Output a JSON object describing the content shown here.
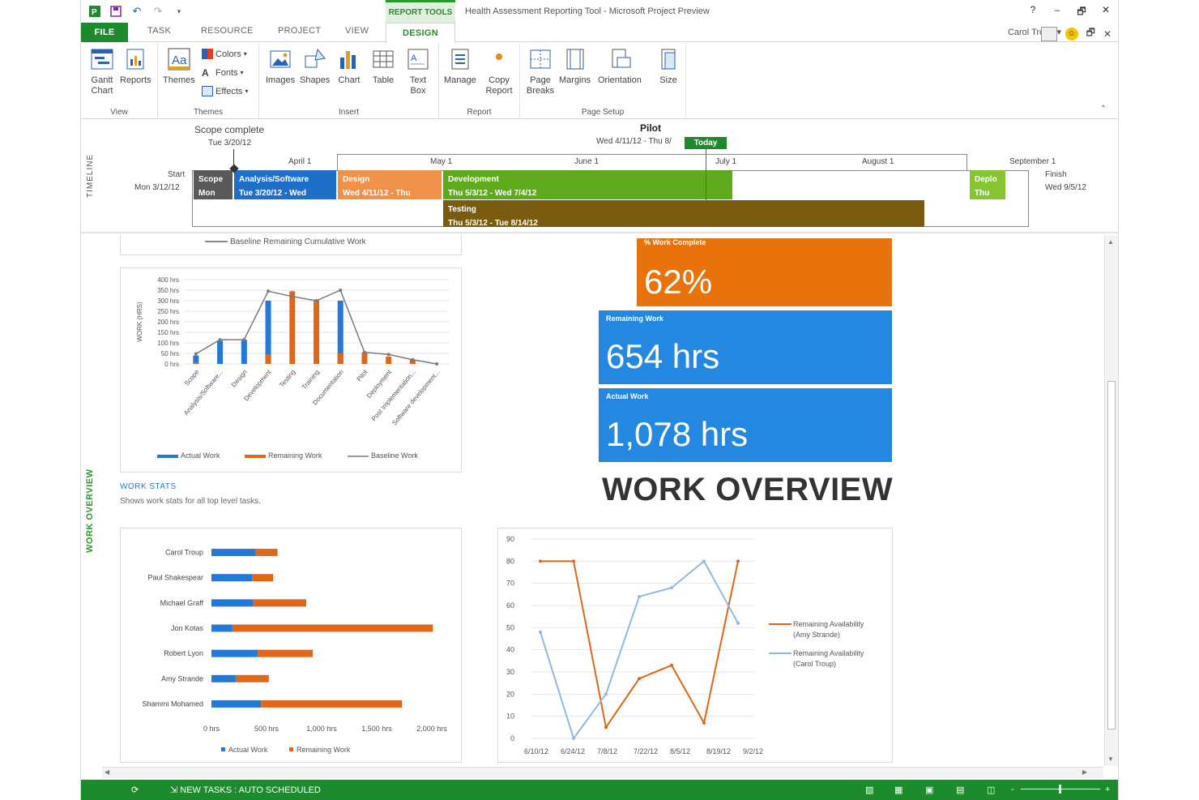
{
  "app": {
    "window_title": "Health Assessment Reporting Tool - Microsoft Project Preview",
    "context_tab_group": "REPORT TOOLS",
    "user_name": "Carol Troup",
    "window_controls": [
      "?",
      "–",
      "🗗",
      "✕"
    ],
    "doc_controls": [
      "🗗",
      "✕"
    ]
  },
  "tabs": {
    "file": "FILE",
    "task": "TASK",
    "resource": "RESOURCE",
    "project": "PROJECT",
    "view": "VIEW",
    "design": "DESIGN"
  },
  "ribbon": {
    "view_group": {
      "label": "View",
      "gantt": "Gantt Chart",
      "reports": "Reports"
    },
    "themes_group": {
      "label": "Themes",
      "themes": "Themes",
      "colors": "Colors",
      "fonts": "Fonts",
      "effects": "Effects"
    },
    "insert_group": {
      "label": "Insert",
      "images": "Images",
      "shapes": "Shapes",
      "chart": "Chart",
      "table": "Table",
      "textbox": "Text Box"
    },
    "report_group": {
      "label": "Report",
      "manage": "Manage",
      "copy": "Copy Report"
    },
    "page_setup_group": {
      "label": "Page Setup",
      "page_breaks": "Page Breaks",
      "margins": "Margins",
      "orientation": "Orientation",
      "size": "Size"
    }
  },
  "timeline": {
    "label": "TIMELINE",
    "scope_complete": "Scope complete",
    "scope_complete_date": "Tue 3/20/12",
    "pilot": "Pilot",
    "pilot_dates": "Wed 4/11/12 - Thu 8/",
    "today": "Today",
    "start_label": "Start",
    "start_date": "Mon 3/12/12",
    "finish_label": "Finish",
    "finish_date": "Wed 9/5/12",
    "months": [
      "April 1",
      "May 1",
      "June 1",
      "July 1",
      "August 1",
      "September 1"
    ],
    "bars": [
      {
        "name": "Scope",
        "dates": "Mon",
        "color": "#595959"
      },
      {
        "name": "Analysis/Software",
        "dates": "Tue 3/20/12 - Wed",
        "color": "#1f6fc8"
      },
      {
        "name": "Design",
        "dates": "Wed 4/11/12 - Thu",
        "color": "#f0914a"
      },
      {
        "name": "Development",
        "dates": "Thu 5/3/12 - Wed 7/4/12",
        "color": "#5faa1c"
      },
      {
        "name": "Deplo",
        "dates": "Thu",
        "color": "#86c532"
      },
      {
        "name": "Testing",
        "dates": "Thu 5/3/12 - Tue 8/14/12",
        "color": "#7a5c10"
      }
    ]
  },
  "report": {
    "side_label": "WORK OVERVIEW",
    "title": "WORK OVERVIEW",
    "work_stats_title": "WORK STATS",
    "work_stats_sub": "Shows work stats for all top level tasks.",
    "legend_top_fragment": "Baseline Remaining Cumulative Work",
    "kpis": [
      {
        "label": "% Work Complete",
        "value": "62%",
        "color": "#e8720c"
      },
      {
        "label": "Remaining Work",
        "value": "654 hrs",
        "color": "#2488e0"
      },
      {
        "label": "Actual Work",
        "value": "1,078 hrs",
        "color": "#2488e0"
      }
    ]
  },
  "chart_data": [
    {
      "type": "bar",
      "title": "",
      "ylabel": "WORK (HRS)",
      "y_ticks": [
        "0 hrs",
        "50 hrs",
        "100 hrs",
        "150 hrs",
        "200 hrs",
        "250 hrs",
        "300 hrs",
        "350 hrs",
        "400 hrs"
      ],
      "ylim": [
        0,
        400
      ],
      "categories": [
        "Scope",
        "Analysis/Software...",
        "Design",
        "Development",
        "Testing",
        "Training",
        "Documentation",
        "Pilot",
        "Deployment",
        "Post Implementation...",
        "Software development..."
      ],
      "series": [
        {
          "name": "Actual Work",
          "kind": "bar",
          "color": "#2478d8",
          "values": [
            40,
            110,
            115,
            300,
            0,
            0,
            300,
            0,
            0,
            0,
            0
          ]
        },
        {
          "name": "Remaining Work",
          "kind": "bar",
          "color": "#e0661a",
          "values": [
            8,
            0,
            0,
            45,
            345,
            305,
            50,
            55,
            35,
            20,
            0
          ]
        },
        {
          "name": "Baseline Work",
          "kind": "line",
          "color": "#7a7a7a",
          "values": [
            48,
            115,
            115,
            345,
            320,
            300,
            350,
            55,
            45,
            20,
            0
          ]
        }
      ]
    },
    {
      "type": "bar",
      "orientation": "horizontal",
      "title": "",
      "x_ticks": [
        "0 hrs",
        "500 hrs",
        "1,000 hrs",
        "1,500 hrs",
        "2,000 hrs"
      ],
      "xlim": [
        0,
        2000
      ],
      "categories": [
        "Carol Troup",
        "Paul Shakespear",
        "Michael Graff",
        "Jon Kotas",
        "Robert Lyon",
        "Amy Strande",
        "Shammi Mohamed"
      ],
      "series": [
        {
          "name": "Actual Work",
          "color": "#2478d8",
          "values": [
            400,
            370,
            380,
            190,
            420,
            220,
            450
          ]
        },
        {
          "name": "Remaining Work",
          "color": "#e0661a",
          "values": [
            200,
            190,
            480,
            1820,
            500,
            300,
            1280
          ]
        }
      ]
    },
    {
      "type": "line",
      "title": "",
      "y_ticks": [
        "0",
        "10",
        "20",
        "30",
        "40",
        "50",
        "60",
        "70",
        "80",
        "90"
      ],
      "ylim": [
        0,
        90
      ],
      "x_tick_labels": [
        "6/10/12",
        "6/24/12",
        "7/8/12",
        "7/22/12",
        "8/5/12",
        "8/19/12",
        "9/2/12"
      ],
      "x": [
        "6/10/12",
        "6/17/12",
        "6/24/12",
        "7/1/12",
        "7/8/12",
        "7/15/12",
        "7/22/12",
        "7/29/12",
        "8/5/12"
      ],
      "series": [
        {
          "name": "Remaining Availability (Amy Strande)",
          "color": "#e0661a",
          "values": [
            80,
            80,
            5,
            27,
            33,
            7,
            80
          ]
        },
        {
          "name": "Remaining Availability (Carol Troup)",
          "color": "#8fb8ea",
          "values": [
            48,
            0,
            20,
            64,
            68,
            80,
            52
          ]
        }
      ]
    }
  ],
  "status": {
    "new_tasks": "NEW TASKS : AUTO SCHEDULED",
    "zoom_minus": "-",
    "zoom_plus": "+"
  }
}
